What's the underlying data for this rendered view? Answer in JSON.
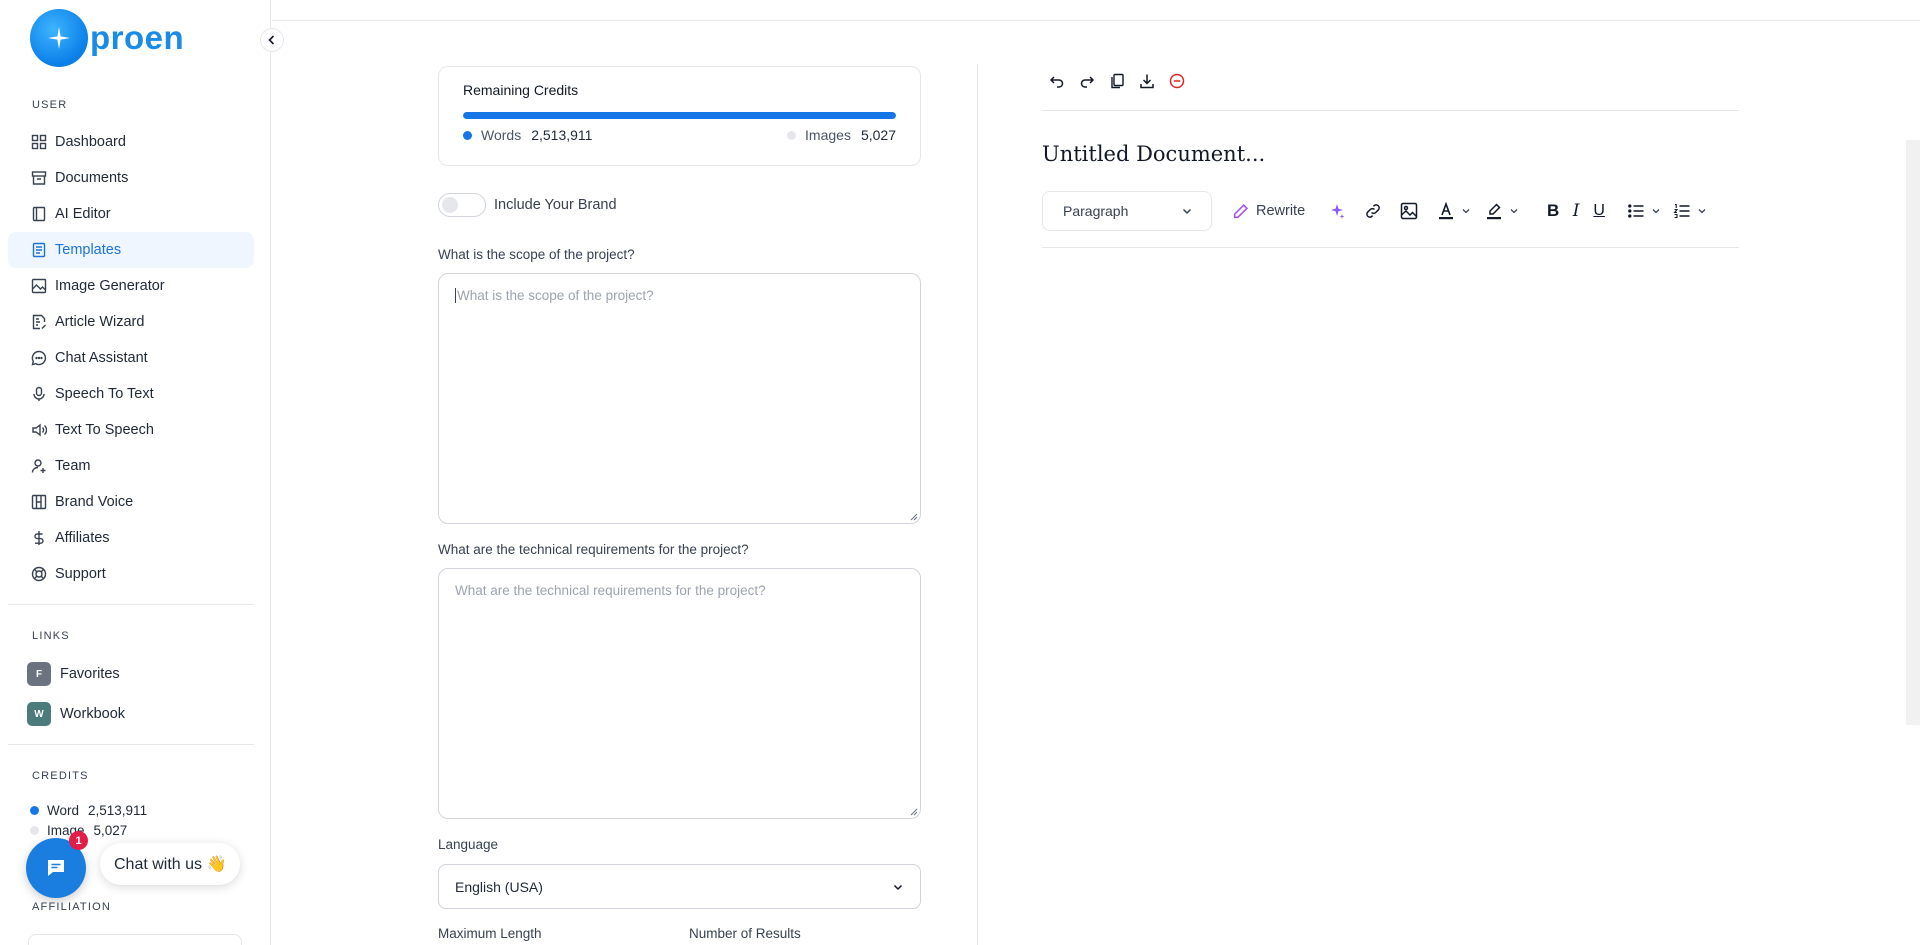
{
  "brand": {
    "name": "proen"
  },
  "sidebar": {
    "user_section": "USER",
    "items": [
      {
        "label": "Dashboard",
        "icon": "dashboard-icon"
      },
      {
        "label": "Documents",
        "icon": "archive-icon"
      },
      {
        "label": "AI Editor",
        "icon": "notebook-icon"
      },
      {
        "label": "Templates",
        "icon": "file-text-icon"
      },
      {
        "label": "Image Generator",
        "icon": "image-icon"
      },
      {
        "label": "Article Wizard",
        "icon": "file-edit-icon"
      },
      {
        "label": "Chat Assistant",
        "icon": "message-circle-icon"
      },
      {
        "label": "Speech To Text",
        "icon": "microphone-icon"
      },
      {
        "label": "Text To Speech",
        "icon": "speaker-icon"
      },
      {
        "label": "Team",
        "icon": "user-plus-icon"
      },
      {
        "label": "Brand Voice",
        "icon": "layout-icon"
      },
      {
        "label": "Affiliates",
        "icon": "dollar-icon"
      },
      {
        "label": "Support",
        "icon": "lifebuoy-icon"
      }
    ],
    "active_item": "Templates",
    "links_section": "LINKS",
    "links": [
      {
        "badge": "F",
        "label": "Favorites",
        "color": "#6b7280"
      },
      {
        "badge": "W",
        "label": "Workbook",
        "color": "#4b7b7b"
      }
    ],
    "credits_section": "CREDITS",
    "credits": [
      {
        "label": "Word",
        "value": "2,513,911",
        "color": "#1576e8"
      },
      {
        "label": "Image",
        "value": "5,027",
        "color": "#e5e7eb"
      }
    ],
    "affiliation_section": "AFFILIATION"
  },
  "chat_widget": {
    "label": "Chat with us 👋",
    "badge": "1"
  },
  "form": {
    "credits_card": {
      "title": "Remaining Credits",
      "words_label": "Words",
      "words_value": "2,513,911",
      "images_label": "Images",
      "images_value": "5,027",
      "words_fraction": 1.0
    },
    "include_brand_label": "Include Your Brand",
    "scope_label": "What is the scope of the project?",
    "scope_placeholder": "What is the scope of the project?",
    "tech_label": "What are the technical requirements for the project?",
    "tech_placeholder": "What are the technical requirements for the project?",
    "language_label": "Language",
    "language_value": "English (USA)",
    "max_length_label": "Maximum Length",
    "num_results_label": "Number of Results"
  },
  "editor": {
    "doc_title": "Untitled Document...",
    "paragraph_select": "Paragraph",
    "rewrite_label": "Rewrite",
    "accent": "#1576e8"
  }
}
